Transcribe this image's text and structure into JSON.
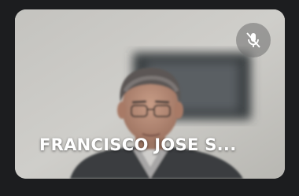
{
  "participant": {
    "name": "FRANCISCO JOSE S...",
    "mic_state": "muted",
    "mute_icon": "mic-off-icon"
  },
  "colors": {
    "window_bg": "#1c1d1f",
    "tile_bg": "#c9c8c3",
    "label_text": "#ffffff"
  }
}
